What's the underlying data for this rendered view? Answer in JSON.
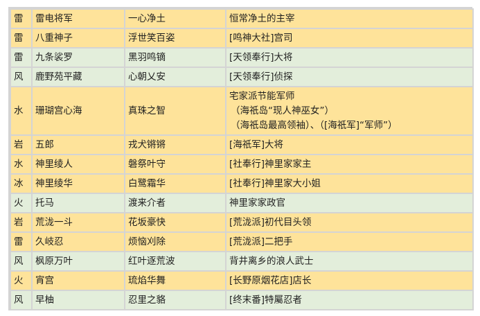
{
  "rows": [
    {
      "element": "雷",
      "name": "雷电将军",
      "title": "一心净土",
      "desc": [
        "恒常净土的主宰"
      ],
      "bg": "yellow"
    },
    {
      "element": "雷",
      "name": "八重神子",
      "title": "浮世笑百姿",
      "desc": [
        "[鸣神大社]宫司"
      ],
      "bg": "yellow"
    },
    {
      "element": "雷",
      "name": "九条裟罗",
      "title": "黑羽鸣镝",
      "desc": [
        "[天领奉行]大将"
      ],
      "bg": "green"
    },
    {
      "element": "风",
      "name": "鹿野苑平藏",
      "title": "心朝乂安",
      "desc": [
        "[天领奉行]侦探"
      ],
      "bg": "green"
    },
    {
      "element": "水",
      "name": "珊瑚宫心海",
      "title": "真珠之智",
      "desc": [
        "宅家派节能军师",
        "（海祇岛“现人神巫女”）",
        "（海祇岛最高领袖）、（[海祇军]“军师”）"
      ],
      "bg": "yellow"
    },
    {
      "element": "岩",
      "name": "五郎",
      "title": "戎犬锵锵",
      "desc": [
        "[海祇军]大将"
      ],
      "bg": "yellow"
    },
    {
      "element": "水",
      "name": "神里绫人",
      "title": "磐祭叶守",
      "desc": [
        "[社奉行]神里家家主"
      ],
      "bg": "yellow"
    },
    {
      "element": "冰",
      "name": "神里绫华",
      "title": "白鹭霜华",
      "desc": [
        "[社奉行]神里家大小姐"
      ],
      "bg": "yellow"
    },
    {
      "element": "火",
      "name": "托马",
      "title": "渡来介者",
      "desc": [
        "神里家家政官"
      ],
      "bg": "green"
    },
    {
      "element": "岩",
      "name": "荒泷一斗",
      "title": "花坂豪快",
      "desc": [
        "[荒泷派]初代目头领"
      ],
      "bg": "yellow"
    },
    {
      "element": "雷",
      "name": "久岐忍",
      "title": "烦恼刈除",
      "desc": [
        "[荒泷派]二把手"
      ],
      "bg": "yellow"
    },
    {
      "element": "风",
      "name": "枫原万叶",
      "title": "红叶逐荒波",
      "desc": [
        "背井离乡的浪人武士"
      ],
      "bg": "green"
    },
    {
      "element": "火",
      "name": "宵宫",
      "title": "琉焰华舞",
      "desc": [
        "[长野原烟花店]店长"
      ],
      "bg": "yellow"
    },
    {
      "element": "风",
      "name": "早柚",
      "title": "忍里之貉",
      "desc": [
        "[终末番]特屬忍者"
      ],
      "bg": "green"
    }
  ],
  "colors": {
    "yellow": "#fee39a",
    "green": "#e3eedb",
    "border": "#d4d4d4"
  }
}
